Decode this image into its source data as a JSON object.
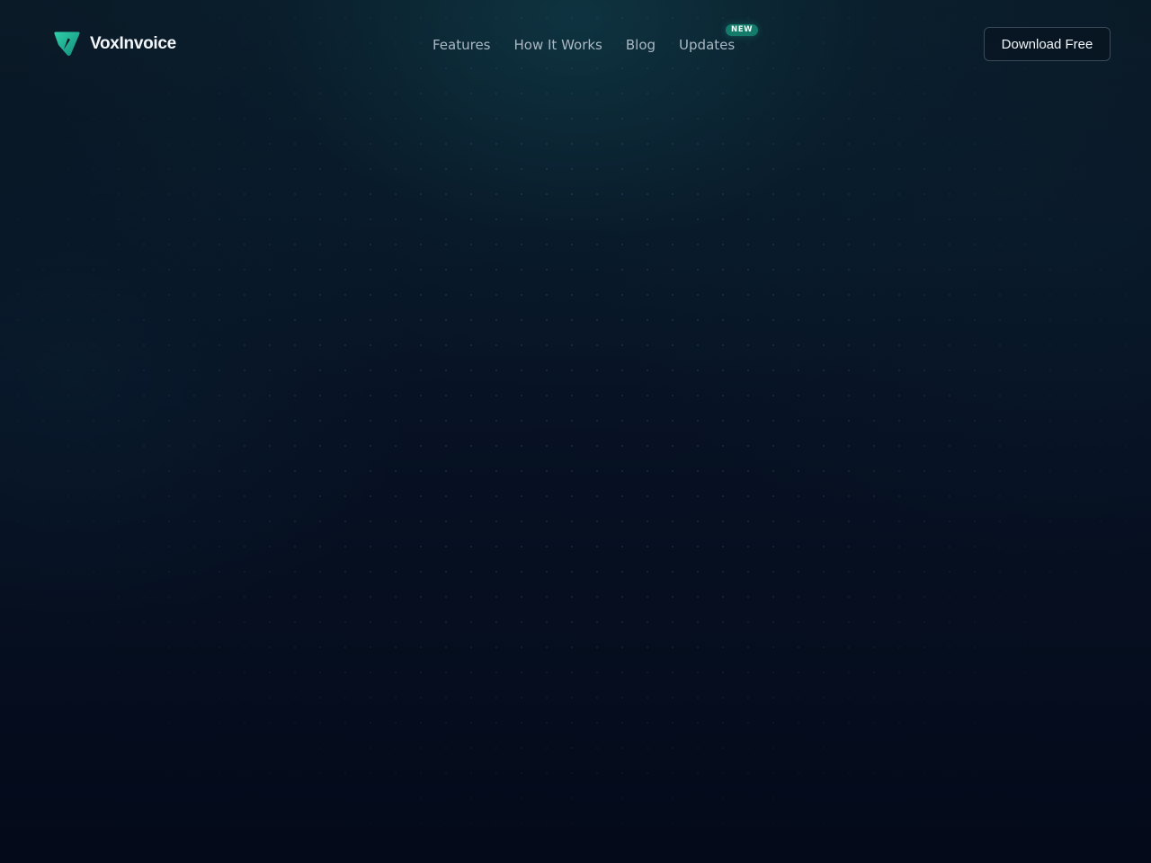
{
  "brand": {
    "name": "VoxInvoice",
    "logo_icon": "voxinvoice-logo-icon",
    "accent_color": "#1fb597"
  },
  "nav": {
    "links": [
      {
        "label": "Features"
      },
      {
        "label": "How It Works"
      },
      {
        "label": "Blog"
      },
      {
        "label": "Updates",
        "badge": "NEW"
      }
    ]
  },
  "cta": {
    "label": "Download Free"
  }
}
